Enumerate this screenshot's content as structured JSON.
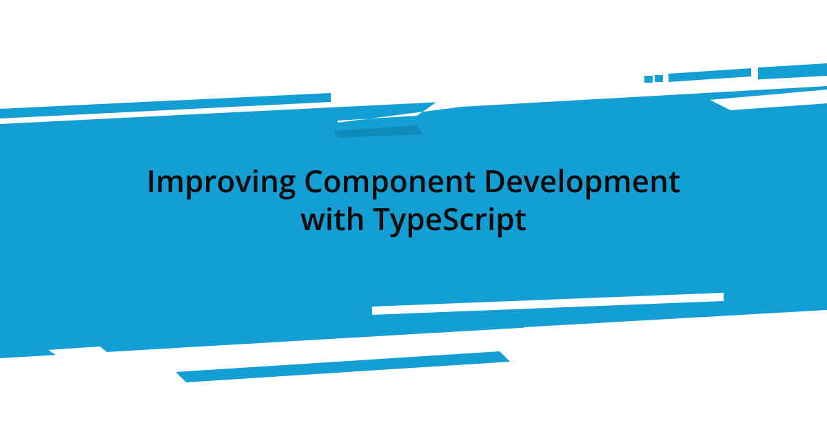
{
  "title_line1": "Improving Component Development",
  "title_line2": "with TypeScript",
  "colors": {
    "primary_blue": "#139FD3",
    "background": "#ffffff",
    "text": "#0a0a0a"
  }
}
